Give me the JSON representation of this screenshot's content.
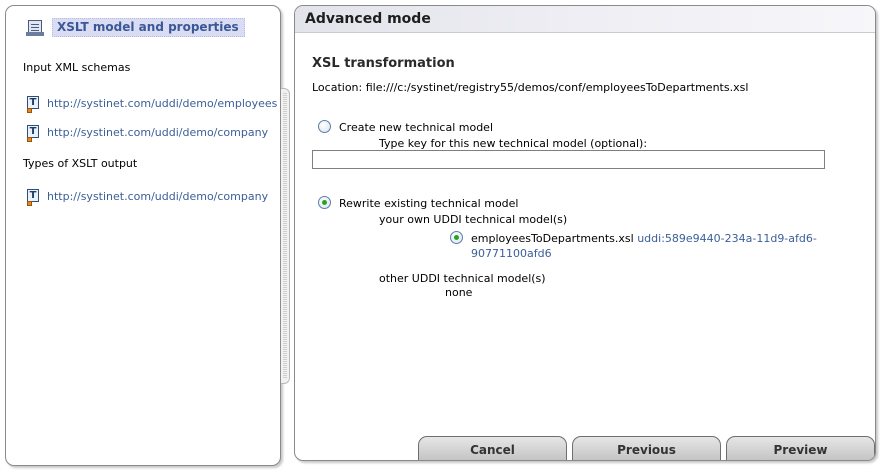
{
  "left_panel": {
    "root_label": "XSLT model and properties",
    "input_heading": "Input XML schemas",
    "input_schemas": [
      "http://systinet.com/uddi/demo/employees",
      "http://systinet.com/uddi/demo/company"
    ],
    "output_heading": "Types of XSLT output",
    "output_types": [
      "http://systinet.com/uddi/demo/company"
    ]
  },
  "right_panel": {
    "title": "Advanced mode",
    "section_title": "XSL transformation",
    "location": "Location: file:///c:/systinet/registry55/demos/conf/employeesToDepartments.xsl",
    "create_option": {
      "label": "Create new technical model",
      "key_prompt": "Type key for this new technical model (optional):",
      "key_value": "",
      "selected": false
    },
    "rewrite_option": {
      "label": "Rewrite existing technical model",
      "selected": true,
      "own_heading": "your own UDDI technical model(s)",
      "own_models": [
        {
          "name": "employeesToDepartments.xsl",
          "key_line1": "uddi:589e9440-234a-11d9-afd6-",
          "key_line2": "90771100afd6",
          "selected": true
        }
      ],
      "other_heading": "other UDDI technical model(s)",
      "other_value": "none"
    }
  },
  "buttons": {
    "cancel": "Cancel",
    "previous": "Previous",
    "preview": "Preview"
  }
}
